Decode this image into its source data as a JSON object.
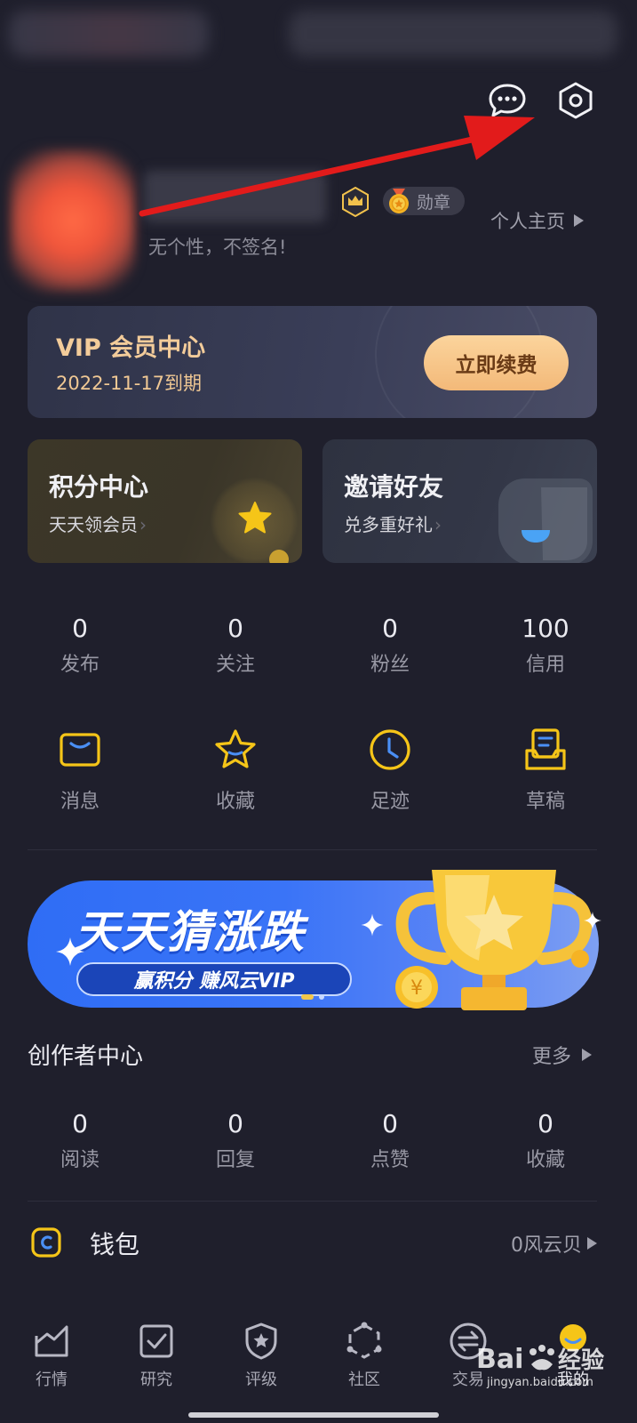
{
  "header": {
    "message_icon": "chat-bubble-icon",
    "settings_icon": "hexagon-settings-icon"
  },
  "profile": {
    "badge_medal": "勋章",
    "signature": "无个性，不签名!",
    "homepage_link": "个人主页"
  },
  "vip": {
    "title": "VIP 会员中心",
    "expire": "2022-11-17到期",
    "renew_button": "立即续费"
  },
  "promos": [
    {
      "title": "积分中心",
      "subtitle": "天天领会员"
    },
    {
      "title": "邀请好友",
      "subtitle": "兑多重好礼"
    }
  ],
  "stats": [
    {
      "value": "0",
      "label": "发布"
    },
    {
      "value": "0",
      "label": "关注"
    },
    {
      "value": "0",
      "label": "粉丝"
    },
    {
      "value": "100",
      "label": "信用"
    }
  ],
  "shortcuts": [
    {
      "label": "消息",
      "icon": "envelope-icon"
    },
    {
      "label": "收藏",
      "icon": "star-icon"
    },
    {
      "label": "足迹",
      "icon": "clock-icon"
    },
    {
      "label": "草稿",
      "icon": "draft-tray-icon"
    }
  ],
  "banner": {
    "title": "天天猜涨跌",
    "subtitle": "赢积分 赚风云VIP"
  },
  "creator": {
    "title": "创作者中心",
    "more": "更多",
    "stats": [
      {
        "value": "0",
        "label": "阅读"
      },
      {
        "value": "0",
        "label": "回复"
      },
      {
        "value": "0",
        "label": "点赞"
      },
      {
        "value": "0",
        "label": "收藏"
      }
    ]
  },
  "wallet": {
    "label": "钱包",
    "value": "0风云贝"
  },
  "bottom_nav": [
    {
      "label": "行情",
      "icon": "market-chart-icon"
    },
    {
      "label": "研究",
      "icon": "checkbox-icon"
    },
    {
      "label": "评级",
      "icon": "shield-star-icon"
    },
    {
      "label": "社区",
      "icon": "community-hexagon-icon"
    },
    {
      "label": "交易",
      "icon": "trade-circle-icon"
    },
    {
      "label": "我的",
      "icon": "profile-icon"
    }
  ],
  "colors": {
    "background": "#1f1f2c",
    "accent_yellow": "#f5c518",
    "vip_gold": "#f3cc9a",
    "banner_blue": "#2f6df5",
    "annotation_arrow": "#e21b1b"
  }
}
